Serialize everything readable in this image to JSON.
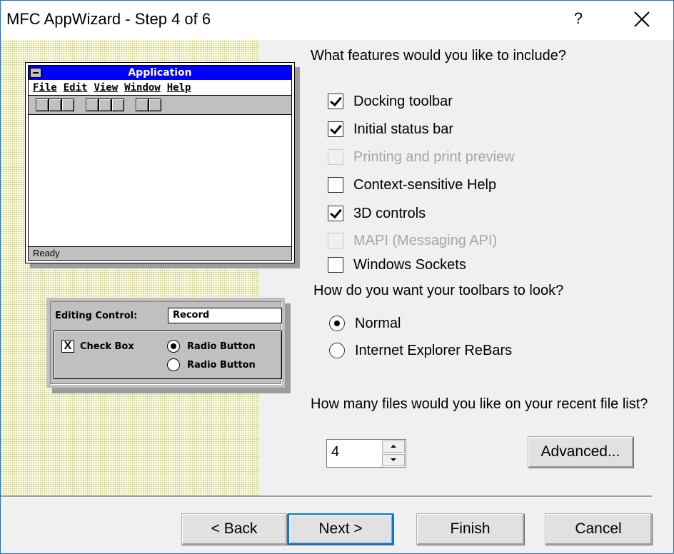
{
  "window": {
    "title": "MFC AppWizard - Step 4 of 6",
    "help": "?"
  },
  "preview": {
    "app_title": "Application",
    "menu": [
      "File",
      "Edit",
      "View",
      "Window",
      "Help"
    ],
    "status": "Ready",
    "dialog": {
      "editing_label": "Editing Control:",
      "editing_value": "Record",
      "checkbox_label": "Check Box",
      "checkbox_mark": "X",
      "radio1": "Radio Button",
      "radio2": "Radio Button"
    }
  },
  "features": {
    "question": "What features would you like to include?",
    "items": [
      {
        "label": "Docking toolbar",
        "checked": true,
        "enabled": true
      },
      {
        "label": "Initial status bar",
        "checked": true,
        "enabled": true
      },
      {
        "label": "Printing and print preview",
        "checked": false,
        "enabled": false
      },
      {
        "label": "Context-sensitive Help",
        "checked": false,
        "enabled": true
      },
      {
        "label": "3D controls",
        "checked": true,
        "enabled": true
      },
      {
        "label": "MAPI (Messaging API)",
        "checked": false,
        "enabled": false
      },
      {
        "label": "Windows Sockets",
        "checked": false,
        "enabled": true
      }
    ]
  },
  "toolbars": {
    "question": "How do you want your toolbars to look?",
    "options": [
      {
        "label": "Normal",
        "selected": true
      },
      {
        "label": "Internet Explorer ReBars",
        "selected": false
      }
    ]
  },
  "recent": {
    "question": "How many files would you like on your recent file list?",
    "value": "4"
  },
  "buttons": {
    "advanced": "Advanced...",
    "back": "< Back",
    "next": "Next >",
    "finish": "Finish",
    "cancel": "Cancel"
  }
}
